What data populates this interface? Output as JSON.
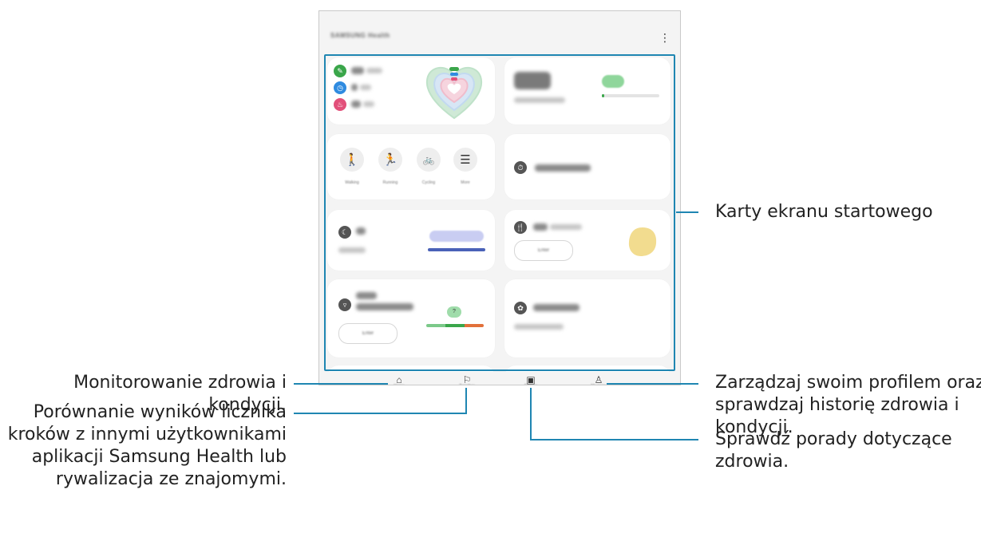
{
  "colors": {
    "leader_line": "#1f86b2",
    "card_bg": "#ffffff",
    "screen_bg": "#f4f4f4",
    "steps_icon": "#3aa64a",
    "active_time_icon": "#2f8be0",
    "calories_icon": "#e2507a",
    "progress_green": "#3aa64a",
    "sleep_bar": "#4a62b8",
    "food_yellow": "#f2dc8f",
    "body_bar_orange": "#e2703a"
  },
  "phone": {
    "menu_icon": "more-vertical-icon"
  },
  "activity_card": {
    "icons": [
      "steps-icon",
      "active-time-icon",
      "calories-icon"
    ]
  },
  "exercise_card": {
    "icons": [
      "walking-icon",
      "running-icon",
      "cycling-icon",
      "more-list-icon"
    ]
  },
  "workout_card": {
    "icon": "stopwatch-icon"
  },
  "sleep_card": {
    "icon": "moon-icon"
  },
  "food_card": {
    "icon": "fork-knife-icon"
  },
  "body_card": {
    "icon": "body-composition-icon",
    "bubble": "?"
  },
  "cycle_card": {
    "icon": "cycle-flower-icon"
  },
  "bottom_nav": [
    {
      "icon": "home-icon"
    },
    {
      "icon": "flag-icon"
    },
    {
      "icon": "fitness-play-icon"
    },
    {
      "icon": "person-icon"
    }
  ],
  "callouts": {
    "home_cards": "Karty ekranu startowego",
    "home_tab": [
      "Monitorowanie zdrowia i",
      "kondycji."
    ],
    "my_page_tab": [
      "Zarządzaj swoim profilem oraz",
      "sprawdzaj historię zdrowia i",
      "kondycji."
    ],
    "together_tab": [
      "Porównanie wyników licznika",
      "kroków z innymi użytkownikami",
      "aplikacji Samsung Health lub",
      "rywalizacja ze znajomymi."
    ],
    "fitness_tab": [
      "Sprawdź porady dotyczące",
      "zdrowia."
    ]
  }
}
